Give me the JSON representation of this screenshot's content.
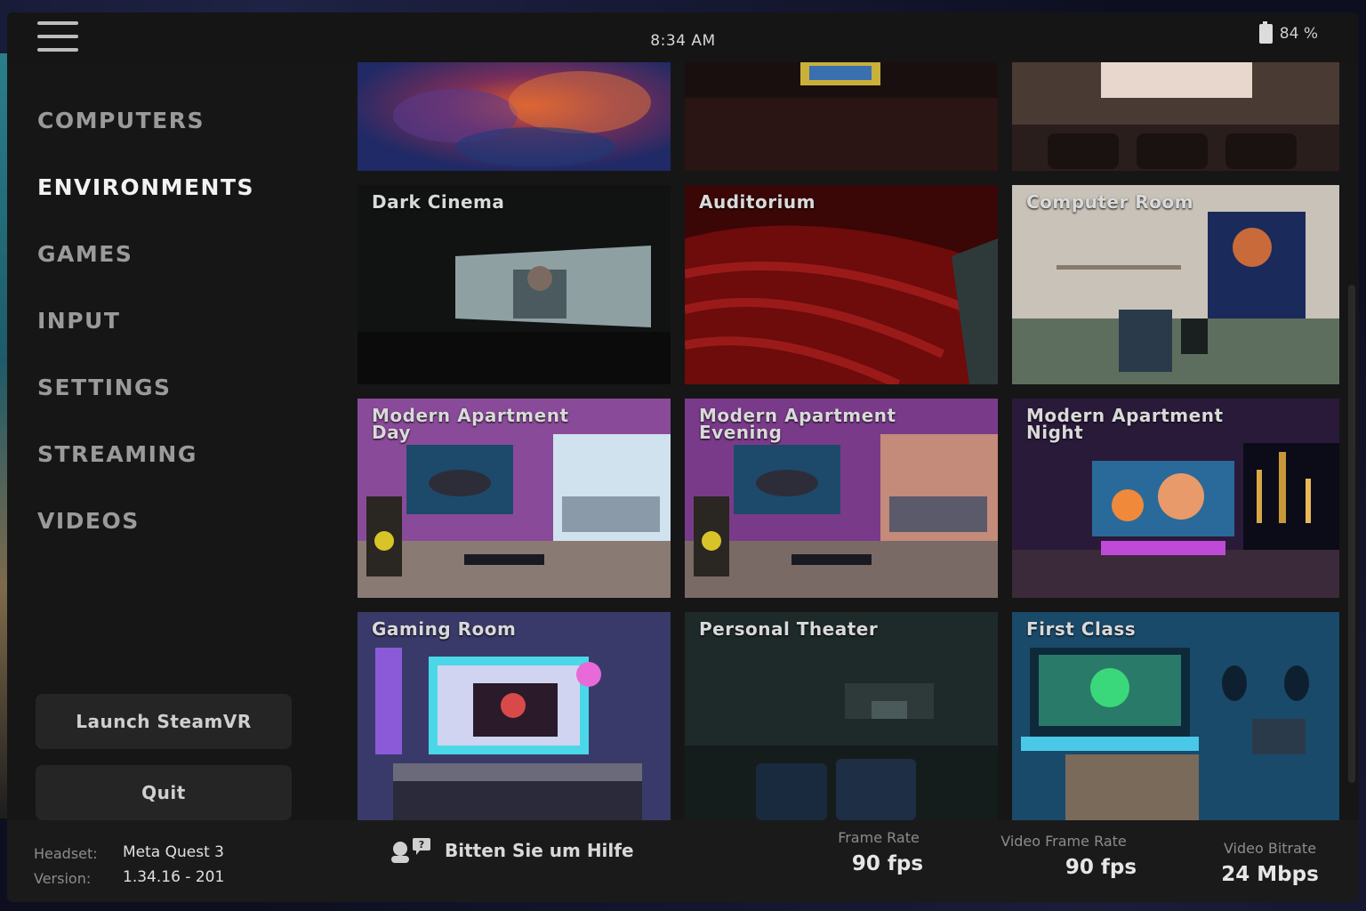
{
  "topbar": {
    "time": "8:34 AM",
    "battery": "84 %"
  },
  "sidebar": {
    "items": [
      {
        "label": "COMPUTERS"
      },
      {
        "label": "ENVIRONMENTS"
      },
      {
        "label": "GAMES"
      },
      {
        "label": "INPUT"
      },
      {
        "label": "SETTINGS"
      },
      {
        "label": "STREAMING"
      },
      {
        "label": "VIDEOS"
      }
    ],
    "active": "ENVIRONMENTS",
    "launch_label": "Launch SteamVR",
    "quit_label": "Quit"
  },
  "environments": [
    {
      "label": ""
    },
    {
      "label": ""
    },
    {
      "label": ""
    },
    {
      "label": "Dark Cinema"
    },
    {
      "label": "Auditorium"
    },
    {
      "label": "Computer Room"
    },
    {
      "label": "Modern Apartment\nDay"
    },
    {
      "label": "Modern Apartment\nEvening"
    },
    {
      "label": "Modern Apartment\nNight"
    },
    {
      "label": "Gaming Room"
    },
    {
      "label": "Personal Theater"
    },
    {
      "label": "First Class"
    }
  ],
  "footer": {
    "headset_label": "Headset:",
    "headset_value": "Meta Quest 3",
    "version_label": "Version:",
    "version_value": "1.34.16 - 201",
    "help_label": "Bitten Sie um Hilfe",
    "frame_rate_label": "Frame Rate",
    "frame_rate_value": "90 fps",
    "video_frame_rate_label": "Video Frame Rate",
    "video_frame_rate_value": "90 fps",
    "video_bitrate_label": "Video Bitrate",
    "video_bitrate_value": "24 Mbps"
  },
  "colors": {
    "active_nav": "#f2f2f2",
    "inactive_nav": "#9a9a9a",
    "panel": "#161616"
  }
}
